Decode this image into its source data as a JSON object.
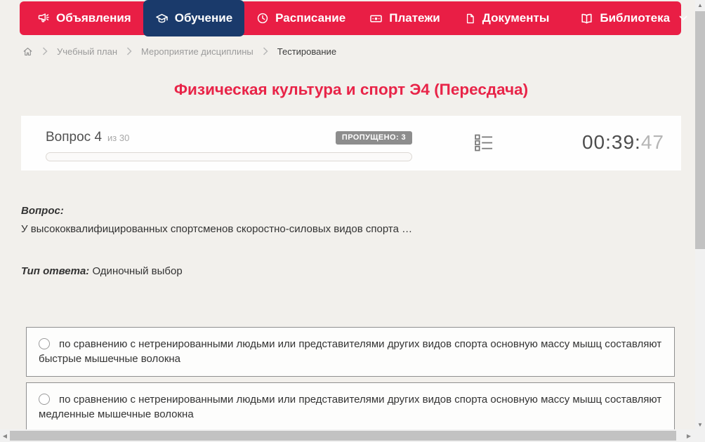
{
  "nav": {
    "items": [
      {
        "label": "Объявления",
        "icon": "megaphone-icon",
        "active": false
      },
      {
        "label": "Обучение",
        "icon": "graduation-cap-icon",
        "active": true
      },
      {
        "label": "Расписание",
        "icon": "clock-icon",
        "active": false
      },
      {
        "label": "Платежи",
        "icon": "banknote-icon",
        "active": false
      },
      {
        "label": "Документы",
        "icon": "document-icon",
        "active": false
      },
      {
        "label": "Библиотека",
        "icon": "book-icon",
        "active": false,
        "has_dropdown": true
      }
    ]
  },
  "breadcrumb": {
    "items": [
      "Учебный план",
      "Мероприятие дисциплины",
      "Тестирование"
    ]
  },
  "page": {
    "title": "Физическая культура и спорт Э4 (Пересдача)"
  },
  "question_header": {
    "question_label": "Вопрос 4",
    "of_label": "из 30",
    "skipped_badge": "ПРОПУЩЕНО: 3",
    "progress_percent": 0,
    "timer": {
      "hours_minutes": "00:39:",
      "seconds": "47"
    }
  },
  "question": {
    "label": "Вопрос:",
    "text": "У высококвалифицированных спортсменов скоростно-силовых видов спорта …",
    "type_label": "Тип ответа:",
    "type_value": "Одиночный выбор"
  },
  "options": [
    {
      "text": "по сравнению с нетренированными людьми или представителями других видов спорта основную массу мышц составляют быстрые мышечные волокна",
      "selected": false
    },
    {
      "text": "по сравнению с нетренированными людьми или представителями других видов спорта основную массу мышц составляют медленные мышечные волокна",
      "selected": false
    }
  ],
  "colors": {
    "nav_red": "#e91e45",
    "active_navy": "#1a3a6b",
    "title_red": "#e82448",
    "badge_gray": "#8d8d8d",
    "page_bg": "#f2f0ec"
  }
}
